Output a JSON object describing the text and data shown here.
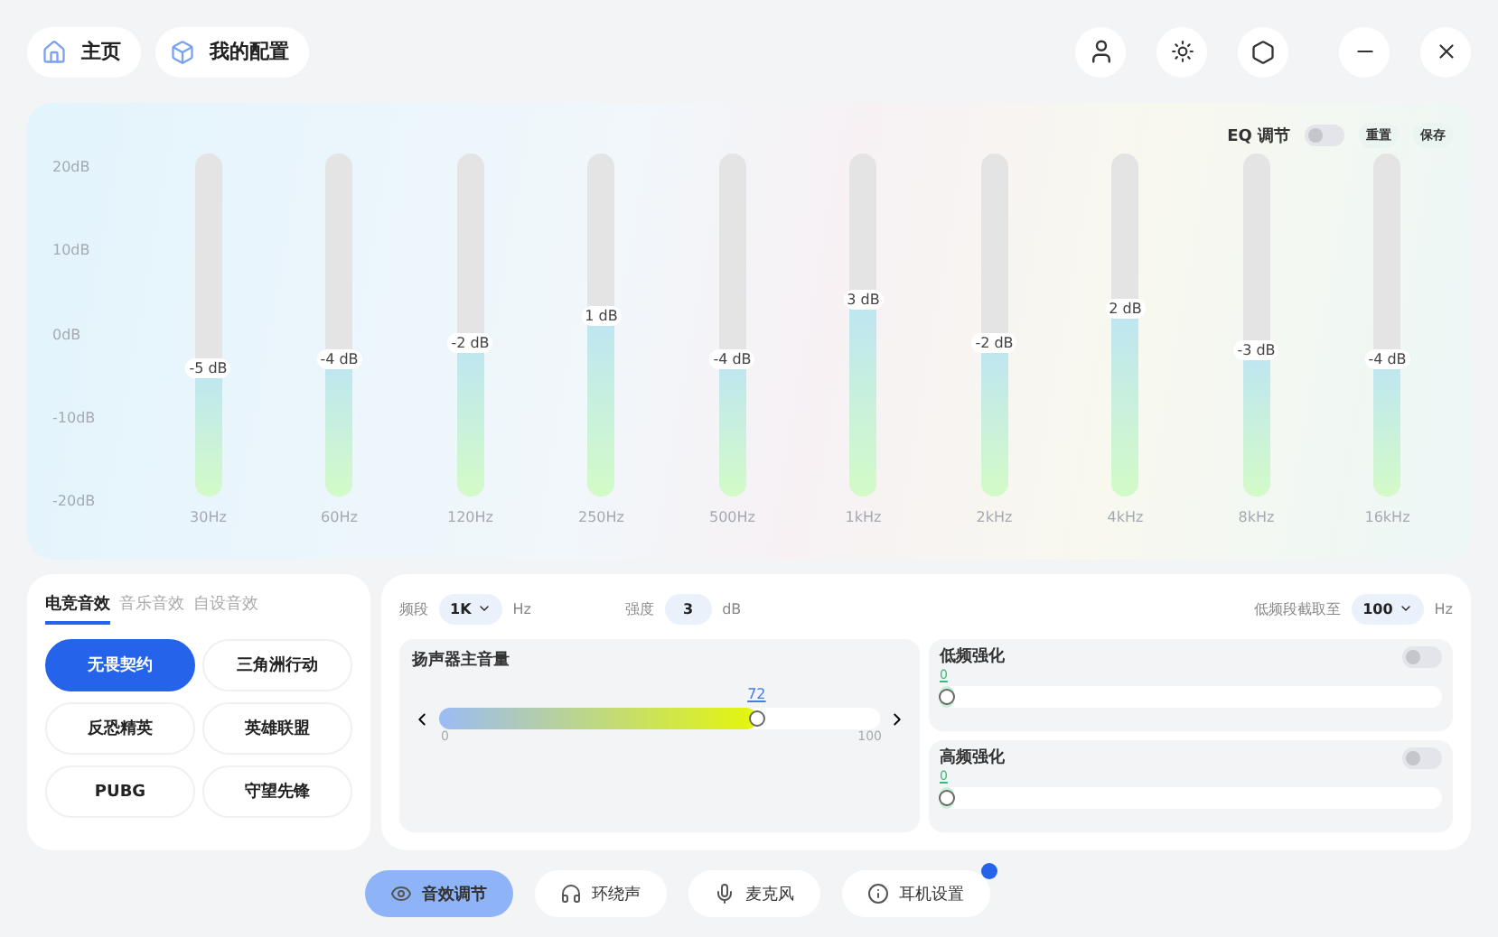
{
  "top_tabs": [
    {
      "label": "主页"
    },
    {
      "label": "我的配置"
    }
  ],
  "eq": {
    "toggle_label": "EQ 调节",
    "on": false,
    "buttons": [
      "重置",
      "保存"
    ],
    "db_ticks": [
      "20dB",
      "10dB",
      "0dB",
      "-10dB",
      "-20dB"
    ],
    "bands": [
      {
        "freq": "30Hz",
        "reading": "-5 dB",
        "level": 0.375
      },
      {
        "freq": "60Hz",
        "reading": "-4 dB",
        "level": 0.4
      },
      {
        "freq": "120Hz",
        "reading": "-2 dB",
        "level": 0.45
      },
      {
        "freq": "250Hz",
        "reading": "1 dB",
        "level": 0.525
      },
      {
        "freq": "500Hz",
        "reading": "-4 dB",
        "level": 0.4
      },
      {
        "freq": "1kHz",
        "reading": "3 dB",
        "level": 0.575
      },
      {
        "freq": "2kHz",
        "reading": "-2 dB",
        "level": 0.45
      },
      {
        "freq": "4kHz",
        "reading": "2 dB",
        "level": 0.55
      },
      {
        "freq": "8kHz",
        "reading": "-3 dB",
        "level": 0.425
      },
      {
        "freq": "16kHz",
        "reading": "-4 dB",
        "level": 0.4
      }
    ]
  },
  "presets": {
    "tabs": [
      {
        "label": "电竞音效",
        "selected": true
      },
      {
        "label": "音乐音效",
        "selected": false
      },
      {
        "label": "自设音效",
        "selected": false
      }
    ],
    "items": [
      {
        "label": "无畏契约",
        "selected": true
      },
      {
        "label": "三角洲行动",
        "selected": false
      },
      {
        "label": "反恐精英",
        "selected": false
      },
      {
        "label": "英雄联盟",
        "selected": false
      },
      {
        "label": "PUBG",
        "selected": false
      },
      {
        "label": "守望先锋",
        "selected": false
      }
    ]
  },
  "settings": {
    "band_label": "频段",
    "band_value": "1K",
    "band_unit": "Hz",
    "strength_label": "强度",
    "strength_value": "3",
    "strength_unit": "dB",
    "cutoff_label": "低频段截取至",
    "cutoff_value": "100",
    "cutoff_unit": "Hz",
    "volume": {
      "title": "扬声器主音量",
      "reading": "72",
      "level": 0.72,
      "min": "0",
      "max": "100"
    },
    "boosts": [
      {
        "title": "低频强化",
        "reading": "0",
        "level": 0,
        "on": false
      },
      {
        "title": "高频强化",
        "reading": "0",
        "level": 0,
        "on": false
      }
    ]
  },
  "bottom_nav": [
    {
      "label": "音效调节",
      "selected": true,
      "badge": false
    },
    {
      "label": "环绕声",
      "selected": false,
      "badge": false
    },
    {
      "label": "麦克风",
      "selected": false,
      "badge": false
    },
    {
      "label": "耳机设置",
      "selected": false,
      "badge": true
    }
  ]
}
